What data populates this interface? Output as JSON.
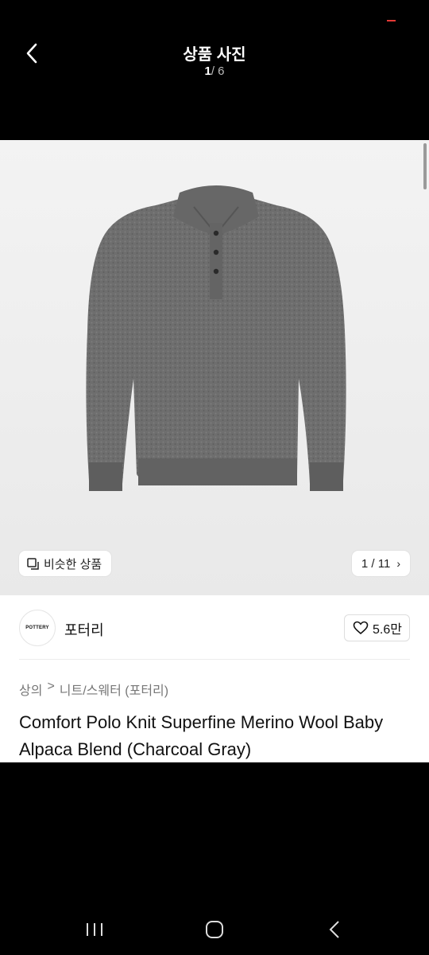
{
  "header": {
    "title": "상품 사진",
    "counter_current": "1",
    "counter_total": "/ 6"
  },
  "photo": {
    "similar_label": "비슷한 상품",
    "pager_text": "1 / 11"
  },
  "brand": {
    "logo_text": "POTTERY",
    "name": "포터리",
    "likes": "5.6만"
  },
  "breadcrumb": {
    "category": "상의",
    "separator": ">",
    "subcategory": "니트/스웨터 (포터리)"
  },
  "product": {
    "name": "Comfort Polo Knit Superfine Merino Wool Baby Alpaca Blend (Charcoal Gray)"
  },
  "colors": {
    "accent_red": "#e53935",
    "sweater": "#6f6f6f"
  }
}
